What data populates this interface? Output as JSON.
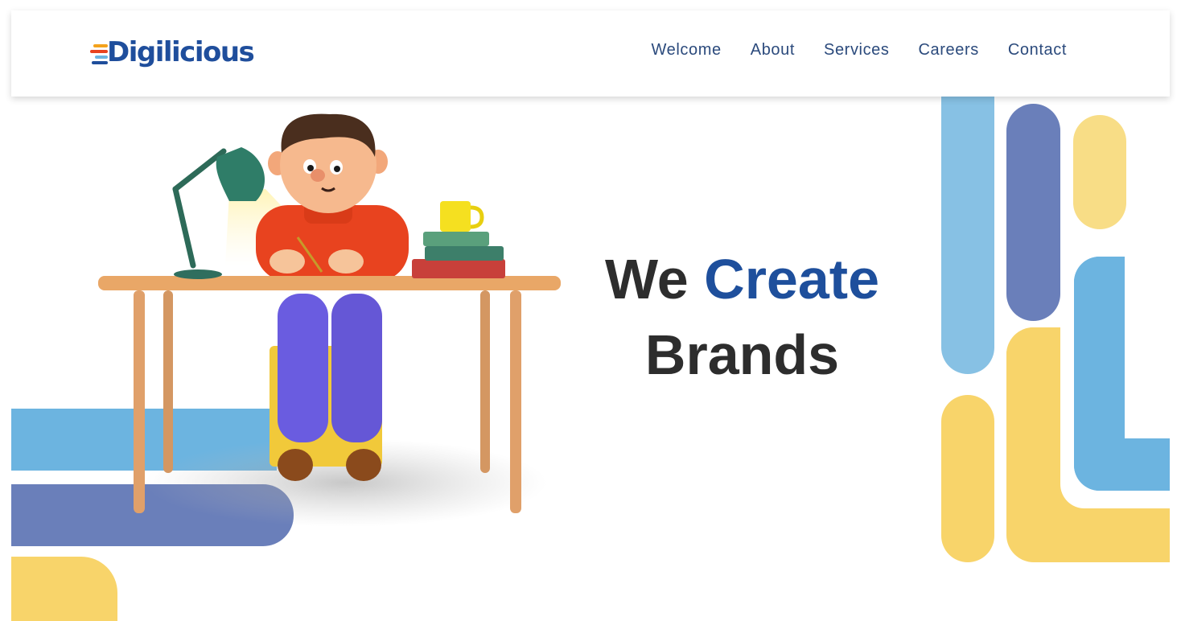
{
  "brand": {
    "logo_text": "Digilicious"
  },
  "nav": {
    "items": [
      "Welcome",
      "About",
      "Services",
      "Careers",
      "Contact"
    ]
  },
  "hero": {
    "line1_word1": "We",
    "line1_word2": "Create",
    "line2": "Brands"
  },
  "colors": {
    "brand_blue": "#1e4f9c",
    "light_blue": "#6cb4e0",
    "periwinkle": "#6a7fba",
    "yellow": "#f8d46a",
    "text_dark": "#2d2d2d"
  },
  "illustration": {
    "subject": "3d-character-writing-at-desk-illustration"
  }
}
